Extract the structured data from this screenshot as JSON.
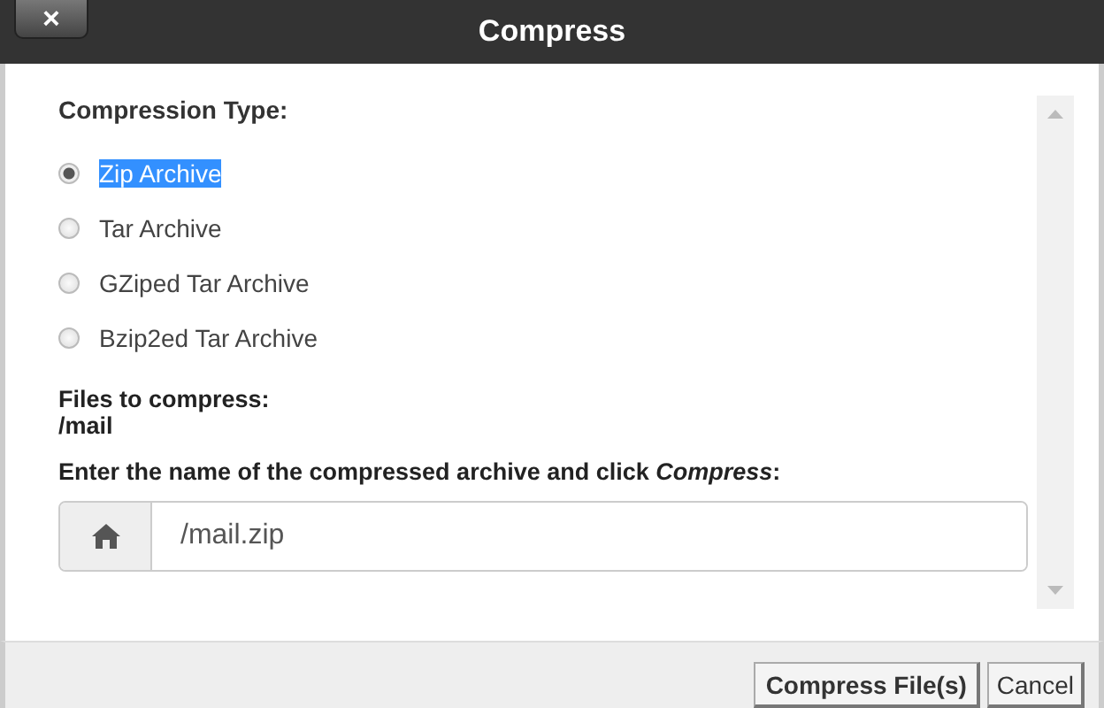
{
  "window": {
    "title": "Compress",
    "close": "×"
  },
  "compression_type": {
    "label": "Compression Type:",
    "options": [
      {
        "label": "Zip Archive",
        "selected": true,
        "highlighted": true
      },
      {
        "label": "Tar Archive",
        "selected": false,
        "highlighted": false
      },
      {
        "label": "GZiped Tar Archive",
        "selected": false,
        "highlighted": false
      },
      {
        "label": "Bzip2ed Tar Archive",
        "selected": false,
        "highlighted": false
      }
    ]
  },
  "files": {
    "label": "Files to compress:",
    "value": "/mail"
  },
  "archive_name": {
    "label": "Enter the name of the compressed archive and click *Compress*:",
    "value": "/mail.zip"
  },
  "buttons": [
    {
      "label": "Compress File(s)",
      "kind": "primary"
    },
    {
      "label": "Cancel",
      "kind": "secondary"
    }
  ]
}
